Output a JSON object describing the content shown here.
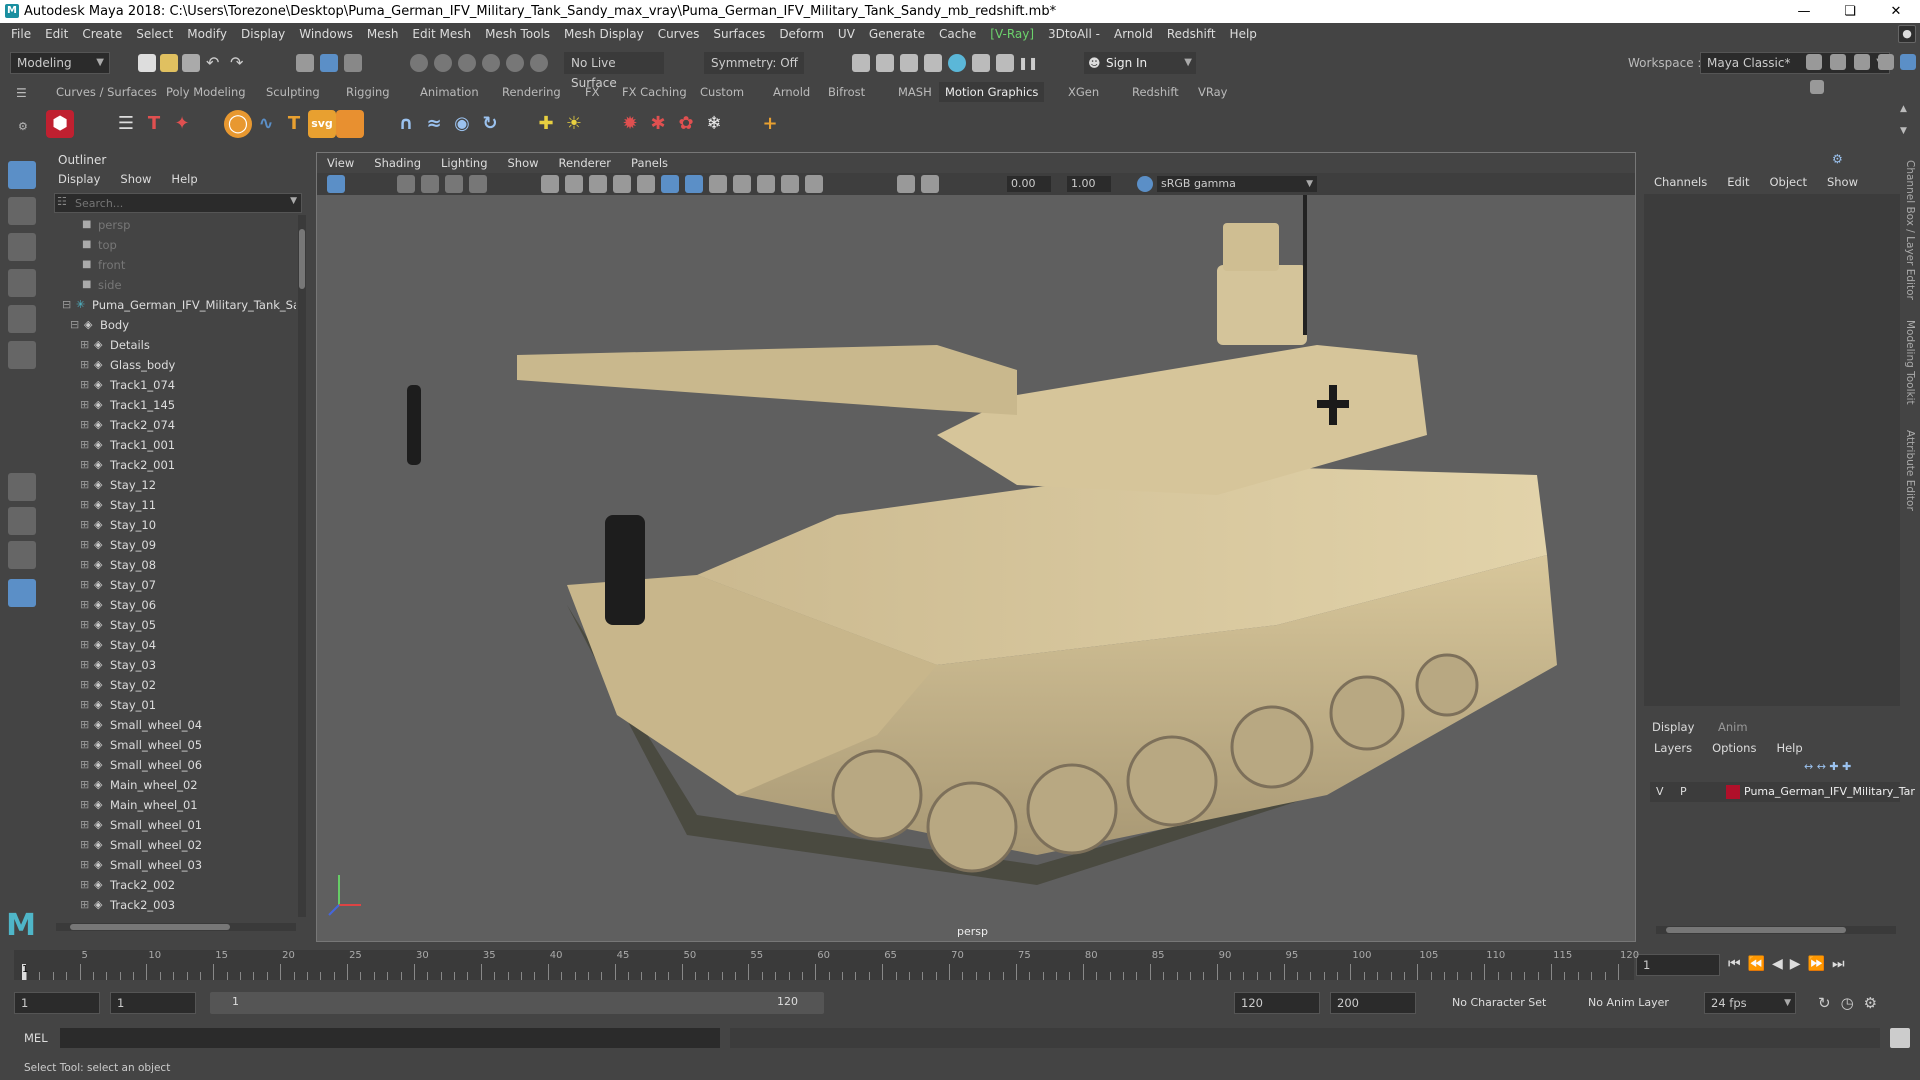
{
  "titlebar": {
    "title": "Autodesk Maya 2018: C:\\Users\\Torezone\\Desktop\\Puma_German_IFV_Military_Tank_Sandy_max_vray\\Puma_German_IFV_Military_Tank_Sandy_mb_redshift.mb*"
  },
  "menu": [
    "File",
    "Edit",
    "Create",
    "Select",
    "Modify",
    "Display",
    "Windows",
    "Mesh",
    "Edit Mesh",
    "Mesh Tools",
    "Mesh Display",
    "Curves",
    "Surfaces",
    "Deform",
    "UV",
    "Generate",
    "Cache",
    "[V-Ray]",
    "3DtoAll -",
    "Arnold",
    "Redshift",
    "Help"
  ],
  "status": {
    "mode": "Modeling",
    "live_surface": "No Live Surface",
    "symmetry": "Symmetry: Off",
    "sign_in": "Sign In",
    "workspace_label": "Workspace :",
    "workspace": "Maya Classic*"
  },
  "shelf_tabs": [
    "Curves / Surfaces",
    "Poly Modeling",
    "Sculpting",
    "Rigging",
    "Animation",
    "Rendering",
    "FX",
    "FX Caching",
    "Custom",
    "Arnold",
    "Bifrost",
    "MASH",
    "Motion Graphics",
    "XGen",
    "Redshift",
    "VRay"
  ],
  "shelf_active": "Motion Graphics",
  "outliner": {
    "title": "Outliner",
    "menu": [
      "Display",
      "Show",
      "Help"
    ],
    "search_placeholder": "Search...",
    "items": [
      {
        "label": "persp",
        "depth": 0,
        "type": "camera"
      },
      {
        "label": "top",
        "depth": 0,
        "type": "camera"
      },
      {
        "label": "front",
        "depth": 0,
        "type": "camera"
      },
      {
        "label": "side",
        "depth": 0,
        "type": "camera"
      },
      {
        "label": "Puma_German_IFV_Military_Tank_San",
        "depth": 0,
        "type": "group"
      },
      {
        "label": "Body",
        "depth": 1,
        "type": "mesh"
      },
      {
        "label": "Details",
        "depth": 2,
        "type": "mesh"
      },
      {
        "label": "Glass_body",
        "depth": 2,
        "type": "mesh"
      },
      {
        "label": "Track1_074",
        "depth": 2,
        "type": "mesh"
      },
      {
        "label": "Track1_145",
        "depth": 2,
        "type": "mesh"
      },
      {
        "label": "Track2_074",
        "depth": 2,
        "type": "mesh"
      },
      {
        "label": "Track1_001",
        "depth": 2,
        "type": "mesh"
      },
      {
        "label": "Track2_001",
        "depth": 2,
        "type": "mesh"
      },
      {
        "label": "Stay_12",
        "depth": 2,
        "type": "mesh"
      },
      {
        "label": "Stay_11",
        "depth": 2,
        "type": "mesh"
      },
      {
        "label": "Stay_10",
        "depth": 2,
        "type": "mesh"
      },
      {
        "label": "Stay_09",
        "depth": 2,
        "type": "mesh"
      },
      {
        "label": "Stay_08",
        "depth": 2,
        "type": "mesh"
      },
      {
        "label": "Stay_07",
        "depth": 2,
        "type": "mesh"
      },
      {
        "label": "Stay_06",
        "depth": 2,
        "type": "mesh"
      },
      {
        "label": "Stay_05",
        "depth": 2,
        "type": "mesh"
      },
      {
        "label": "Stay_04",
        "depth": 2,
        "type": "mesh"
      },
      {
        "label": "Stay_03",
        "depth": 2,
        "type": "mesh"
      },
      {
        "label": "Stay_02",
        "depth": 2,
        "type": "mesh"
      },
      {
        "label": "Stay_01",
        "depth": 2,
        "type": "mesh"
      },
      {
        "label": "Small_wheel_04",
        "depth": 2,
        "type": "mesh"
      },
      {
        "label": "Small_wheel_05",
        "depth": 2,
        "type": "mesh"
      },
      {
        "label": "Small_wheel_06",
        "depth": 2,
        "type": "mesh"
      },
      {
        "label": "Main_wheel_02",
        "depth": 2,
        "type": "mesh"
      },
      {
        "label": "Main_wheel_01",
        "depth": 2,
        "type": "mesh"
      },
      {
        "label": "Small_wheel_01",
        "depth": 2,
        "type": "mesh"
      },
      {
        "label": "Small_wheel_02",
        "depth": 2,
        "type": "mesh"
      },
      {
        "label": "Small_wheel_03",
        "depth": 2,
        "type": "mesh"
      },
      {
        "label": "Track2_002",
        "depth": 2,
        "type": "mesh"
      },
      {
        "label": "Track2_003",
        "depth": 2,
        "type": "mesh"
      }
    ]
  },
  "viewport": {
    "menu": [
      "View",
      "Shading",
      "Lighting",
      "Show",
      "Renderer",
      "Panels"
    ],
    "value_a": "0.00",
    "value_b": "1.00",
    "color_space": "sRGB gamma",
    "camera_label": "persp"
  },
  "channel_box": {
    "menu": [
      "Channels",
      "Edit",
      "Object",
      "Show"
    ],
    "side_tabs": [
      "Channel Box / Layer Editor",
      "Modeling Toolkit",
      "Attribute Editor"
    ]
  },
  "layer_editor": {
    "tabs": [
      "Display",
      "Anim"
    ],
    "menu": [
      "Layers",
      "Options",
      "Help"
    ],
    "layer": {
      "v": "V",
      "p": "P",
      "name": "Puma_German_IFV_Military_Tar",
      "color": "#b0102a"
    }
  },
  "timeline": {
    "labels": [
      "5",
      "10",
      "15",
      "20",
      "25",
      "30",
      "35",
      "40",
      "45",
      "50",
      "55",
      "60",
      "65",
      "70",
      "75",
      "80",
      "85",
      "90",
      "95",
      "100",
      "105",
      "110",
      "115",
      "120"
    ],
    "start_marker": "1",
    "current_frame": "1"
  },
  "range": {
    "start": "1",
    "anim_start": "1",
    "slider_start": "1",
    "slider_end": "120",
    "end": "120",
    "anim_end": "200",
    "character_set": "No Character Set",
    "anim_layer": "No Anim Layer",
    "fps": "24 fps"
  },
  "mel": {
    "label": "MEL"
  },
  "help": {
    "text": "Select Tool: select an object"
  },
  "colors": {
    "accent_blue": "#5b8fc7",
    "vray_green": "#6cd26c",
    "tank_sand": "#cdbb8c"
  }
}
